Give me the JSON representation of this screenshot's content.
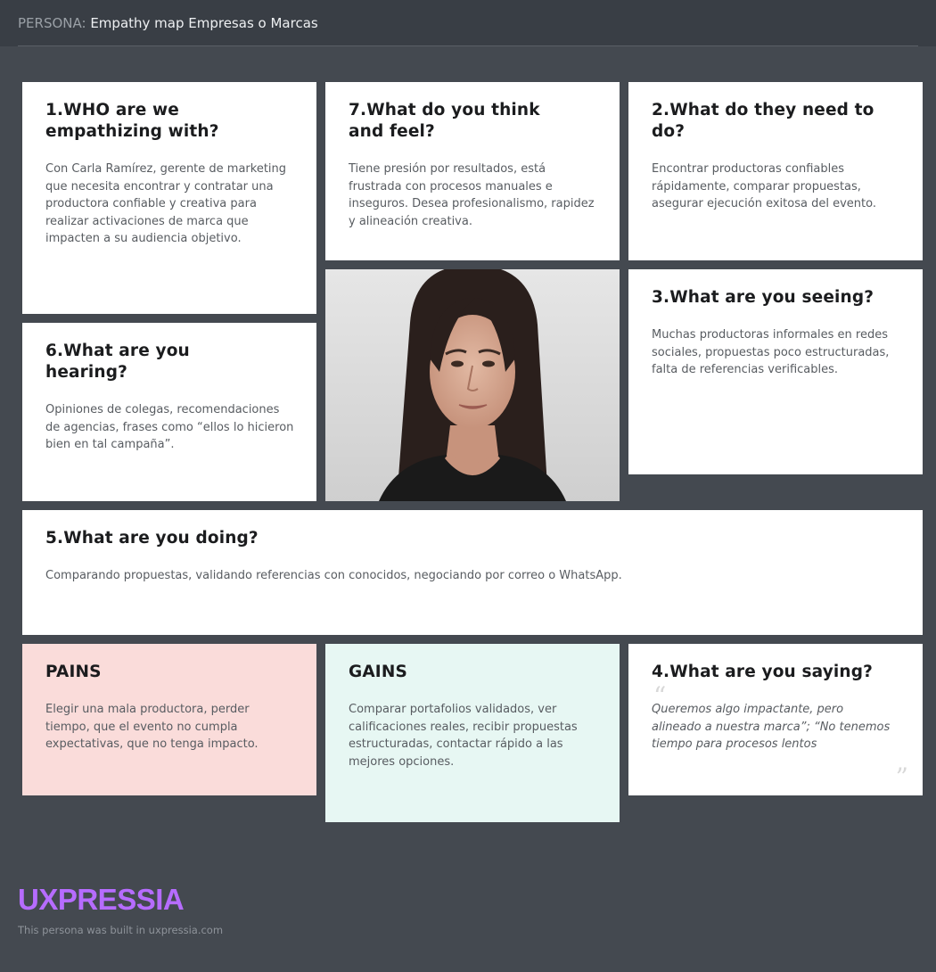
{
  "header": {
    "prefix": "PERSONA:",
    "title": "Empathy map Empresas o Marcas"
  },
  "cards": {
    "who": {
      "title": "1.WHO are we empathizing with?",
      "text": "Con Carla Ramírez, gerente de marketing que necesita encontrar y contratar una productora confiable y creativa para realizar activaciones de marca que impacten a su audiencia objetivo."
    },
    "think": {
      "title": "7.What do you think and feel?",
      "text": "Tiene presión por resultados, está frustrada con procesos manuales e inseguros. Desea profesionalismo, rapidez y alineación creativa."
    },
    "need": {
      "title": "2.What do they need to do?",
      "text": "Encontrar productoras confiables rápidamente, comparar propuestas, asegurar ejecución exitosa del evento."
    },
    "hearing": {
      "title": "6.What are you hearing?",
      "text": "Opiniones de colegas, recomendaciones de agencias, frases como “ellos lo hicieron bien en tal campaña”."
    },
    "seeing": {
      "title": "3.What are you seeing?",
      "text": "Muchas productoras informales en redes sociales, propuestas poco estructuradas, falta de referencias verificables."
    },
    "doing": {
      "title": "5.What are you doing?",
      "text": "Comparando propuestas, validando referencias con conocidos, negociando por correo o WhatsApp."
    },
    "pains": {
      "title": "PAINS",
      "text": "Elegir una mala productora, perder tiempo, que el evento no cumpla expectativas, que no tenga impacto."
    },
    "gains": {
      "title": "GAINS",
      "text": "Comparar portafolios validados, ver calificaciones reales, recibir propuestas estructuradas, contactar rápido a las mejores opciones."
    },
    "saying": {
      "title": "4.What are you saying?",
      "quote": "Queremos algo impactante, pero alineado a nuestra marca”; “No tenemos tiempo para procesos lentos"
    }
  },
  "photo": {
    "icon": "persona-portrait"
  },
  "footer": {
    "logo": "UXPRESSIA",
    "note": "This persona was built in uxpressia.com"
  },
  "colors": {
    "background": "#444950",
    "header": "#393e45",
    "card": "#ffffff",
    "pains": "#fadcda",
    "gains": "#e7f7f3",
    "logo": "#b66cff"
  }
}
